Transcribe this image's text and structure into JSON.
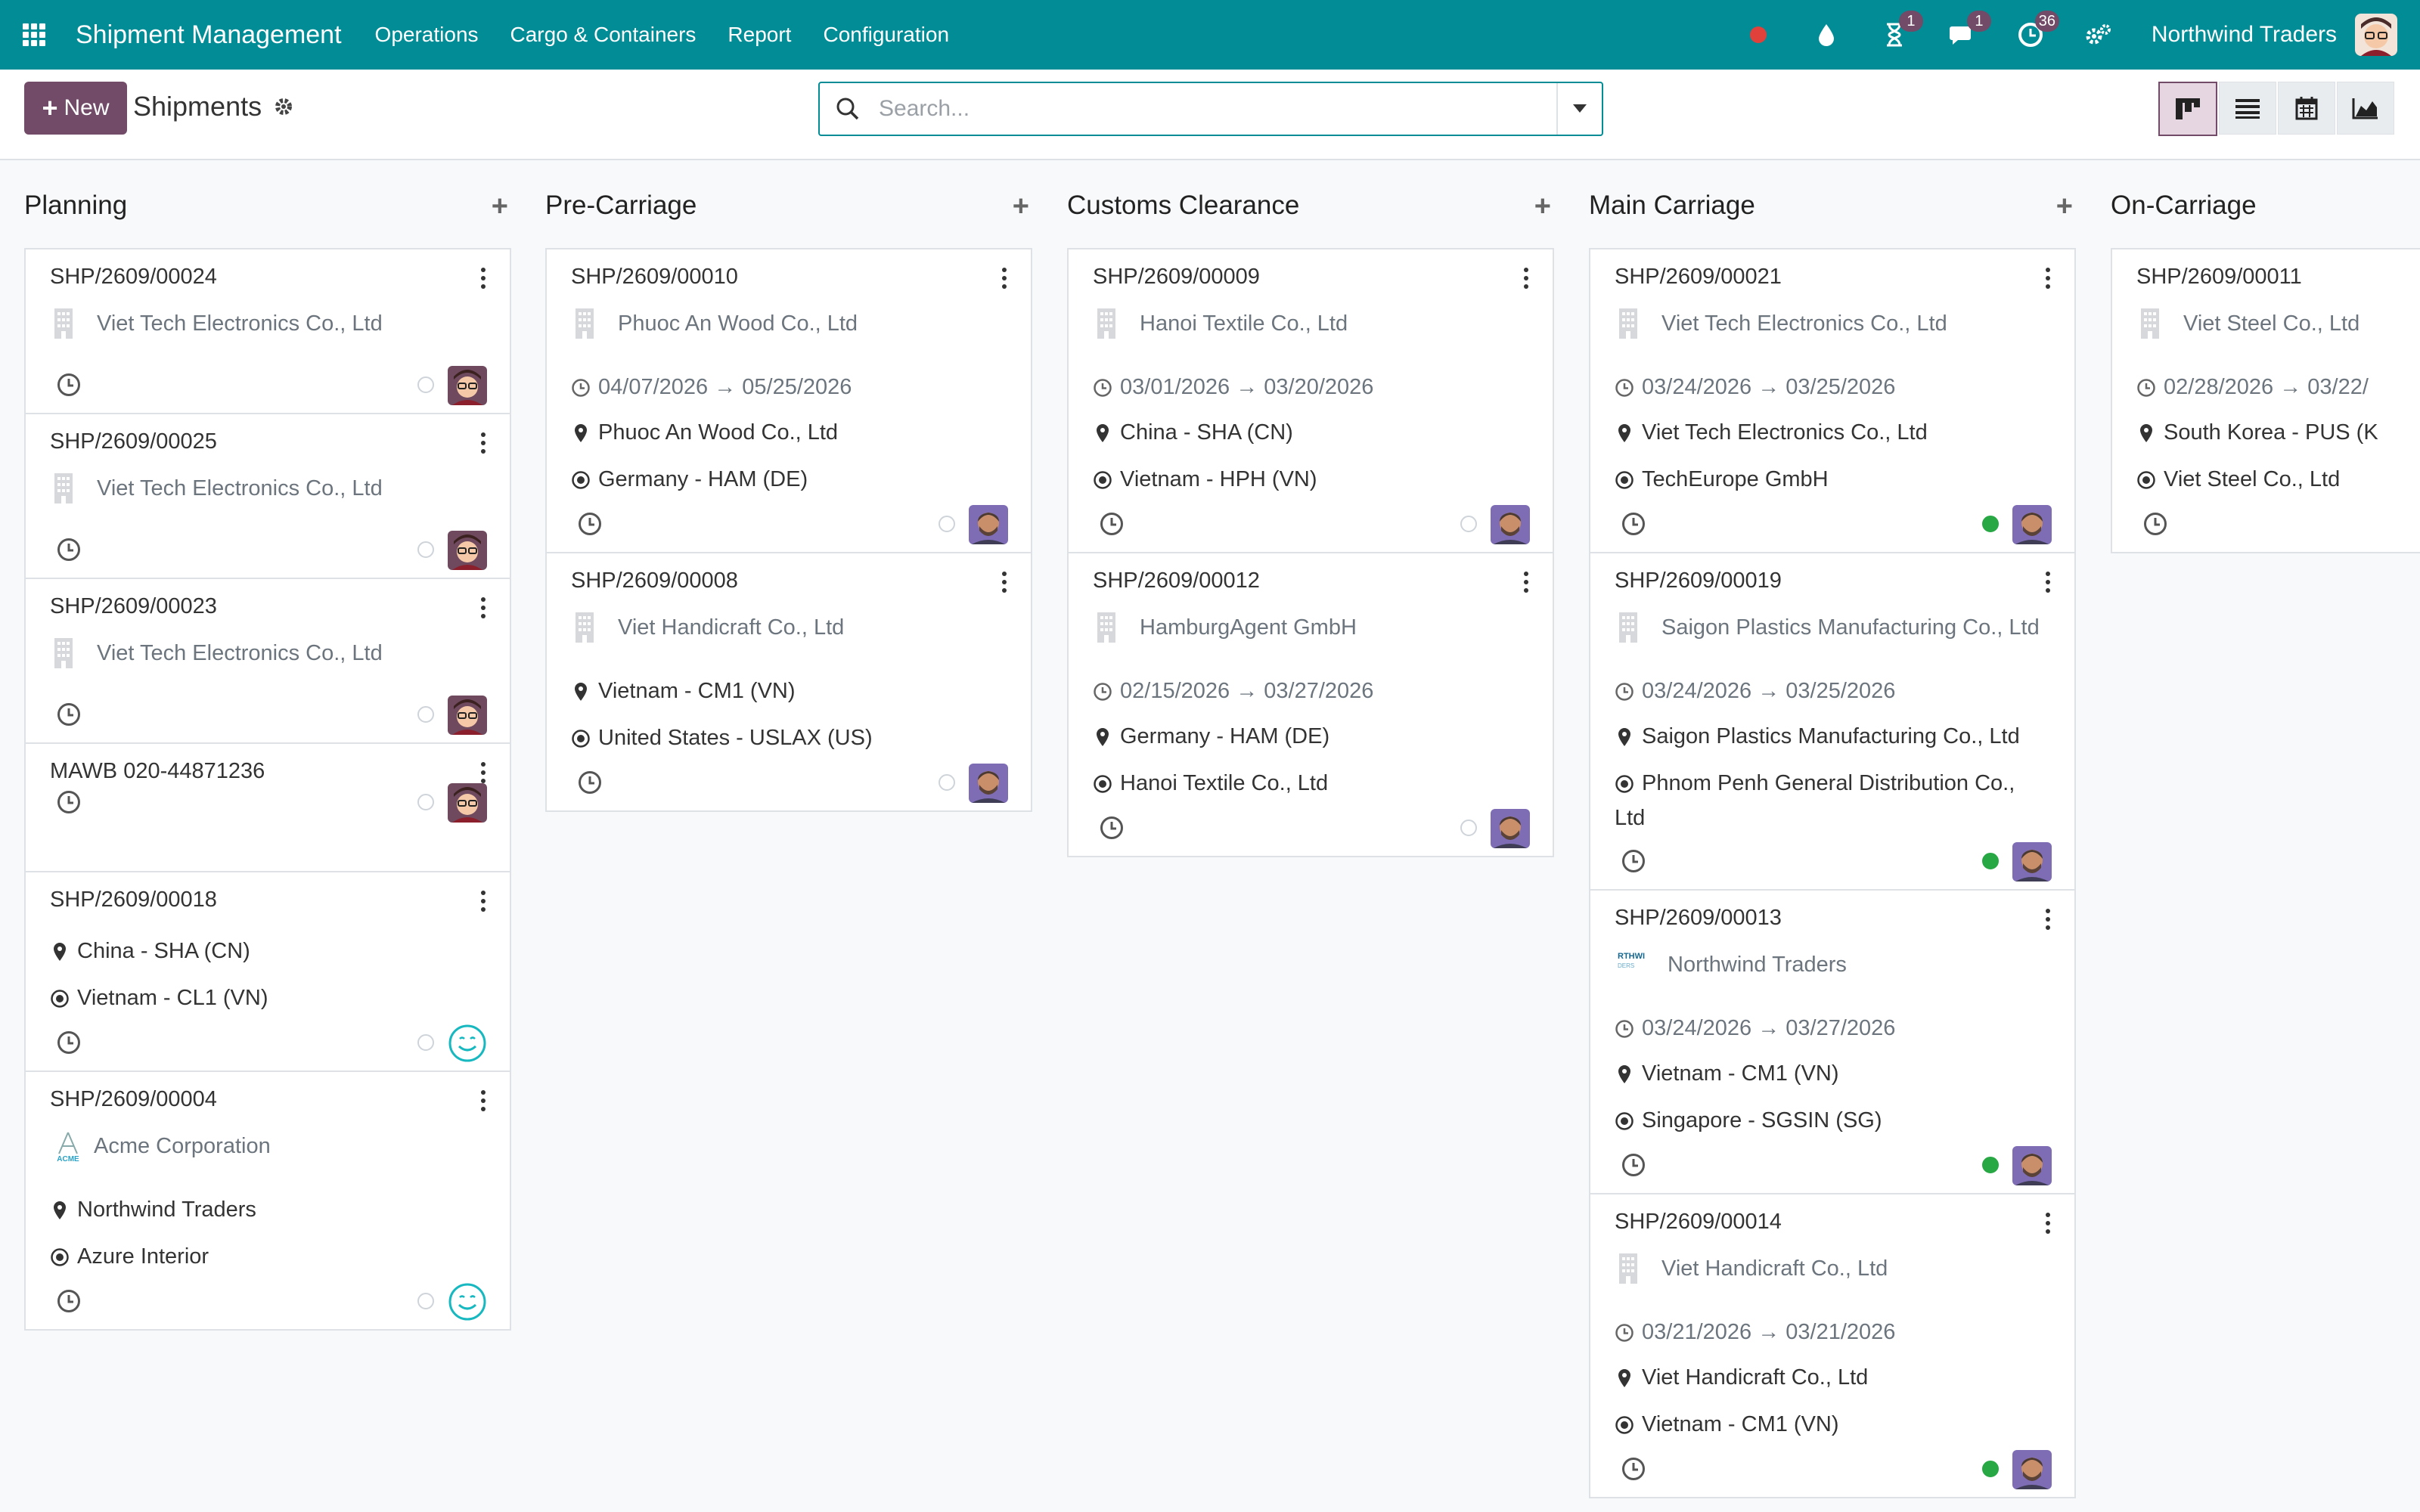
{
  "navbar": {
    "app_title": "Shipment Management",
    "menus": [
      "Operations",
      "Cargo & Containers",
      "Report",
      "Configuration"
    ],
    "badges": {
      "activity": "1",
      "messages": "1",
      "clock": "36"
    },
    "company": "Northwind Traders",
    "bg_color": "#018c96"
  },
  "control": {
    "new_label": "New",
    "breadcrumb": "Shipments",
    "search_placeholder": "Search...",
    "views": [
      "kanban-icon",
      "list-icon",
      "calendar-icon",
      "graph-icon"
    ],
    "accent": "#714b67"
  },
  "columns": [
    {
      "title": "Planning",
      "cards": [
        {
          "ref": "SHP/2609/00024",
          "partner": "Viet Tech Electronics Co., Ltd",
          "status": "grey",
          "assignee": "mitchell"
        },
        {
          "ref": "SHP/2609/00025",
          "partner": "Viet Tech Electronics Co., Ltd",
          "status": "grey",
          "assignee": "mitchell"
        },
        {
          "ref": "SHP/2609/00023",
          "partner": "Viet Tech Electronics Co., Ltd",
          "status": "grey",
          "assignee": "mitchell"
        },
        {
          "ref": "MAWB 020-44871236",
          "status": "grey",
          "assignee": "mitchell"
        },
        {
          "ref": "SHP/2609/00018",
          "origin": "China - SHA (CN)",
          "destination": "Vietnam - CL1 (VN)",
          "status": "grey",
          "assignee": "unassigned"
        },
        {
          "ref": "SHP/2609/00004",
          "partner": "Acme Corporation",
          "origin": "Northwind Traders",
          "destination": "Azure Interior",
          "status": "grey",
          "assignee": "unassigned"
        }
      ]
    },
    {
      "title": "Pre-Carriage",
      "cards": [
        {
          "ref": "SHP/2609/00010",
          "partner": "Phuoc An Wood Co., Ltd",
          "dates": "04/07/2026 → 05/25/2026",
          "origin": "Phuoc An Wood Co., Ltd",
          "destination": "Germany - HAM (DE)",
          "status": "grey",
          "assignee": "marc"
        },
        {
          "ref": "SHP/2609/00008",
          "partner": "Viet Handicraft Co., Ltd",
          "origin": "Vietnam - CM1 (VN)",
          "destination": "United States - USLAX (US)",
          "status": "grey",
          "assignee": "marc"
        }
      ]
    },
    {
      "title": "Customs Clearance",
      "cards": [
        {
          "ref": "SHP/2609/00009",
          "partner": "Hanoi Textile Co., Ltd",
          "dates": "03/01/2026 → 03/20/2026",
          "origin": "China - SHA (CN)",
          "destination": "Vietnam - HPH (VN)",
          "status": "grey",
          "assignee": "marc"
        },
        {
          "ref": "SHP/2609/00012",
          "partner": "HamburgAgent GmbH",
          "dates": "02/15/2026 → 03/27/2026",
          "origin": "Germany - HAM (DE)",
          "destination": "Hanoi Textile Co., Ltd",
          "status": "grey",
          "assignee": "marc"
        }
      ]
    },
    {
      "title": "Main Carriage",
      "cards": [
        {
          "ref": "SHP/2609/00021",
          "partner": "Viet Tech Electronics Co., Ltd",
          "dates": "03/24/2026 → 03/25/2026",
          "origin": "Viet Tech Electronics Co., Ltd",
          "destination": "TechEurope GmbH",
          "status": "green",
          "assignee": "marc"
        },
        {
          "ref": "SHP/2609/00019",
          "partner": "Saigon Plastics Manufacturing Co., Ltd",
          "dates": "03/24/2026 → 03/25/2026",
          "origin": "Saigon Plastics Manufacturing Co., Ltd",
          "destination": "Phnom Penh General Distribution Co., ",
          "destination_wrap": "Ltd",
          "status": "green",
          "assignee": "marc"
        },
        {
          "ref": "SHP/2609/00013",
          "partner": "Northwind Traders",
          "partner_logo": "RTHWI",
          "dates": "03/24/2026 → 03/27/2026",
          "origin": "Vietnam - CM1 (VN)",
          "destination": "Singapore - SGSIN (SG)",
          "status": "green",
          "assignee": "marc"
        },
        {
          "ref": "SHP/2609/00014",
          "partner": "Viet Handicraft Co., Ltd",
          "dates": "03/21/2026 → 03/21/2026",
          "origin": "Viet Handicraft Co., Ltd",
          "destination": "Vietnam - CM1 (VN)",
          "status": "green",
          "assignee": "marc"
        }
      ]
    },
    {
      "title": "On-Carriage",
      "cards": [
        {
          "ref": "SHP/2609/00011",
          "partner": "Viet Steel Co., Ltd",
          "dates": "02/28/2026 → 03/22/",
          "origin": "South Korea - PUS (K",
          "destination": "Viet Steel Co., Ltd"
        }
      ]
    }
  ]
}
